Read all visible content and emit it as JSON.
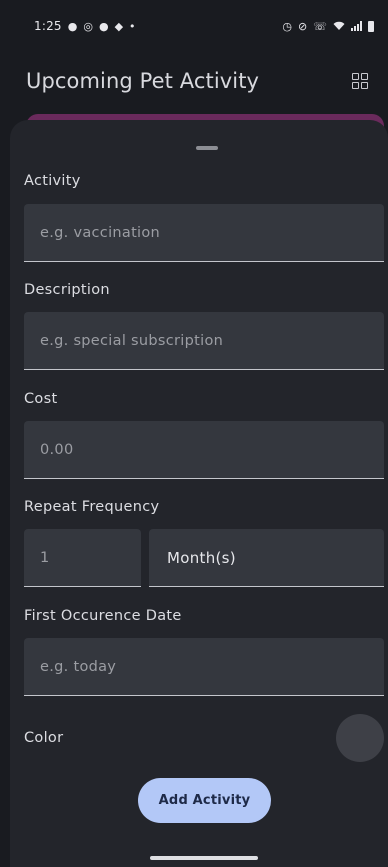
{
  "status_bar": {
    "time": "1:25",
    "left_icons": [
      "chat-icon",
      "instagram-icon",
      "check-circle-icon",
      "cloud-icon",
      "dot-icon"
    ],
    "right_icons": [
      "alarm-icon",
      "mute-icon",
      "call-icon",
      "wifi-icon",
      "signal-icon",
      "battery-icon"
    ]
  },
  "app_bar": {
    "title": "Upcoming Pet Activity",
    "action_icon": "grid-view-icon"
  },
  "accent_colors": {
    "peek_card": "#6a2a5c",
    "button": "#b3c8f7"
  },
  "form": {
    "activity": {
      "label": "Activity",
      "placeholder": "e.g. vaccination"
    },
    "description": {
      "label": "Description",
      "placeholder": "e.g. special subscription"
    },
    "cost": {
      "label": "Cost",
      "placeholder": "0.00"
    },
    "repeat": {
      "label": "Repeat Frequency",
      "count_placeholder": "1",
      "unit_value": "Month(s)"
    },
    "first_date": {
      "label": "First Occurence Date",
      "placeholder": "e.g. today"
    },
    "color": {
      "label": "Color"
    },
    "submit_label": "Add Activity"
  }
}
